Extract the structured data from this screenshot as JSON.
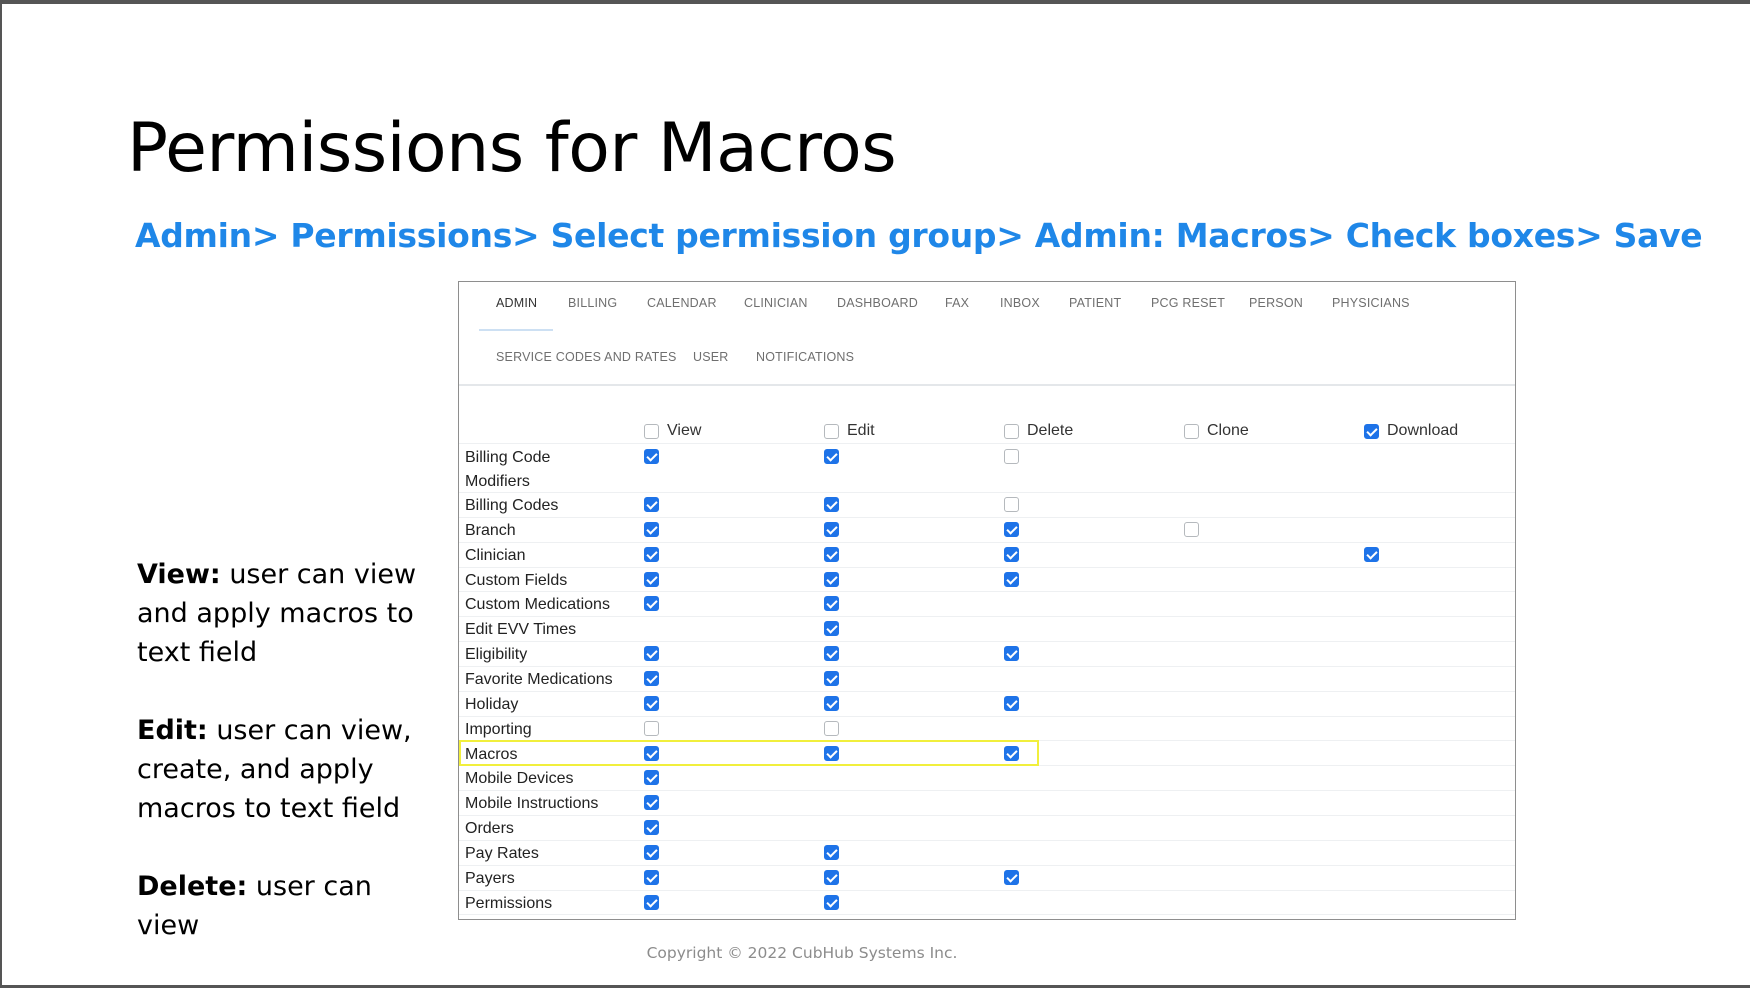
{
  "slide": {
    "title": "Permissions for Macros",
    "subtitle": "Admin> Permissions> Select permission group> Admin: Macros> Check boxes> Save",
    "notes": [
      {
        "term": "View:",
        "text": " user can view and apply macros to text field"
      },
      {
        "term": "Edit:",
        "text": " user can view, create, and apply macros to text field"
      },
      {
        "term": "Delete:",
        "text": " user can view"
      }
    ],
    "footer": "Copyright © 2022 CubHub Systems Inc."
  },
  "tabs": [
    {
      "label": "ADMIN",
      "active": true
    },
    {
      "label": "BILLING",
      "active": false
    },
    {
      "label": "CALENDAR",
      "active": false
    },
    {
      "label": "CLINICIAN",
      "active": false
    },
    {
      "label": "DASHBOARD",
      "active": false
    },
    {
      "label": "FAX",
      "active": false
    },
    {
      "label": "INBOX",
      "active": false
    },
    {
      "label": "PATIENT",
      "active": false
    },
    {
      "label": "PCG RESET",
      "active": false
    },
    {
      "label": "PERSON",
      "active": false
    },
    {
      "label": "PHYSICIANS",
      "active": false
    },
    {
      "label": "SERVICE CODES AND RATES",
      "active": false
    },
    {
      "label": "USER",
      "active": false
    },
    {
      "label": "NOTIFICATIONS",
      "active": false
    }
  ],
  "columns": [
    {
      "label": "View",
      "checked": false
    },
    {
      "label": "Edit",
      "checked": false
    },
    {
      "label": "Delete",
      "checked": false
    },
    {
      "label": "Clone",
      "checked": false
    },
    {
      "label": "Download",
      "checked": true
    }
  ],
  "rows": [
    {
      "label": "Billing Code Modifiers",
      "cells": [
        true,
        true,
        false,
        null,
        null
      ]
    },
    {
      "label": "Billing Codes",
      "cells": [
        true,
        true,
        false,
        null,
        null
      ]
    },
    {
      "label": "Branch",
      "cells": [
        true,
        true,
        true,
        false,
        null
      ]
    },
    {
      "label": "Clinician",
      "cells": [
        true,
        true,
        true,
        null,
        true
      ]
    },
    {
      "label": "Custom Fields",
      "cells": [
        true,
        true,
        true,
        null,
        null
      ]
    },
    {
      "label": "Custom Medications",
      "cells": [
        true,
        true,
        null,
        null,
        null
      ]
    },
    {
      "label": "Edit EVV Times",
      "cells": [
        null,
        true,
        null,
        null,
        null
      ]
    },
    {
      "label": "Eligibility",
      "cells": [
        true,
        true,
        true,
        null,
        null
      ]
    },
    {
      "label": "Favorite Medications",
      "cells": [
        true,
        true,
        null,
        null,
        null
      ]
    },
    {
      "label": "Holiday",
      "cells": [
        true,
        true,
        true,
        null,
        null
      ]
    },
    {
      "label": "Importing",
      "cells": [
        false,
        false,
        null,
        null,
        null
      ]
    },
    {
      "label": "Macros",
      "cells": [
        true,
        true,
        true,
        null,
        null
      ],
      "highlighted": true
    },
    {
      "label": "Mobile Devices",
      "cells": [
        true,
        null,
        null,
        null,
        null
      ]
    },
    {
      "label": "Mobile Instructions",
      "cells": [
        true,
        null,
        null,
        null,
        null
      ]
    },
    {
      "label": "Orders",
      "cells": [
        true,
        null,
        null,
        null,
        null
      ]
    },
    {
      "label": "Pay Rates",
      "cells": [
        true,
        true,
        null,
        null,
        null
      ]
    },
    {
      "label": "Payers",
      "cells": [
        true,
        true,
        true,
        null,
        null
      ]
    },
    {
      "label": "Permissions",
      "cells": [
        true,
        true,
        null,
        null,
        null
      ]
    }
  ],
  "colors": {
    "accent": "#1e73e8",
    "subtitle": "#1f87e8",
    "highlight": "#f1ef3c"
  }
}
